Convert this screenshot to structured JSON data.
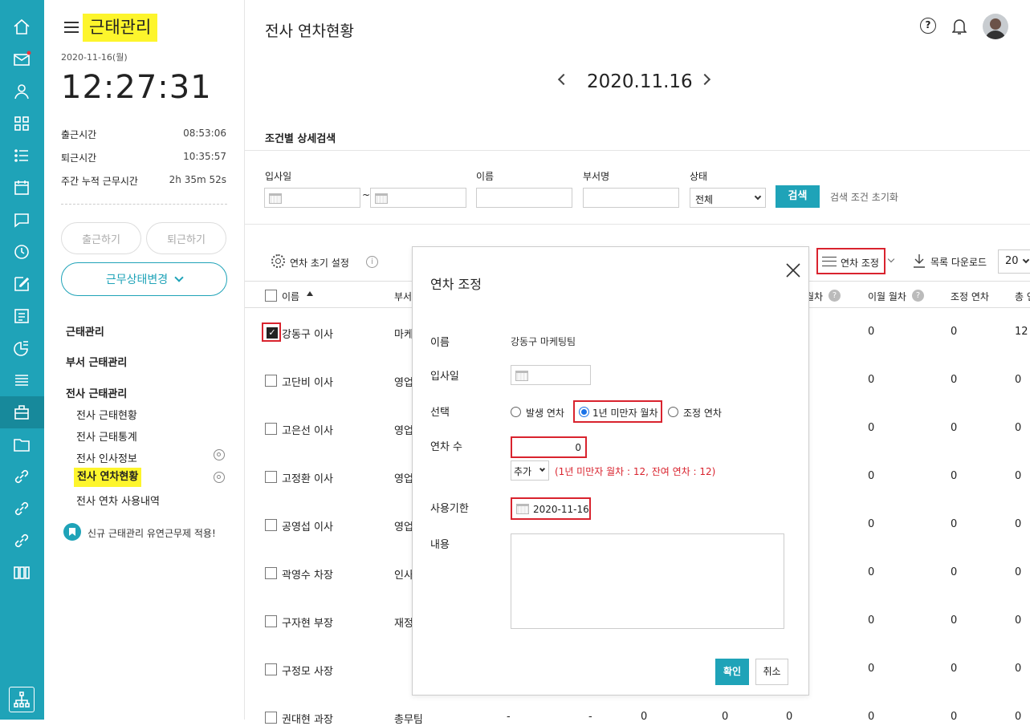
{
  "app_title": "근태관리",
  "date_label": "2020-11-16(월)",
  "clock": "12:27:31",
  "stats": [
    {
      "label": "출근시간",
      "value": "08:53:06"
    },
    {
      "label": "퇴근시간",
      "value": "10:35:57"
    },
    {
      "label": "주간 누적 근무시간",
      "value": "2h 35m 52s"
    }
  ],
  "buttons": {
    "clock_in": "출근하기",
    "clock_out": "퇴근하기",
    "status_change": "근무상태변경"
  },
  "menu": {
    "groups": [
      "근태관리",
      "부서 근태관리",
      "전사 근태관리"
    ],
    "sub": [
      "전사 근태현황",
      "전사 근태통계",
      "전사 인사정보",
      "전사 연차현황",
      "전사 연차 사용내역"
    ],
    "notice": "신규 근태관리 유연근무제 적용!"
  },
  "page_title": "전사 연차현황",
  "nav_date": "2020.11.16",
  "search": {
    "title": "조건별 상세검색",
    "labels": [
      "입사일",
      "이름",
      "부서명",
      "상태"
    ],
    "tilde": "~",
    "status_value": "전체",
    "search_btn": "검색",
    "reset": "검색 조건 초기화"
  },
  "toolbar": {
    "init": "연차 초기 설정",
    "adjust": "연차 조정",
    "download": "목록 다운로드",
    "page_size": "20"
  },
  "table": {
    "headers": {
      "name": "이름",
      "dept": "부서",
      "h_a": "월차",
      "h_b": "이월 월차",
      "h_c": "조정 연차",
      "h_d": "총 연"
    },
    "rows": [
      {
        "name": "강동구 이사",
        "dept": "마케",
        "a": "0",
        "b": "0",
        "c": "12"
      },
      {
        "name": "고단비 이사",
        "dept": "영업",
        "a": "0",
        "b": "0",
        "c": "0"
      },
      {
        "name": "고은선 이사",
        "dept": "영업",
        "a": "0",
        "b": "0",
        "c": "0"
      },
      {
        "name": "고정환 이사",
        "dept": "영업",
        "a": "0",
        "b": "0",
        "c": "0"
      },
      {
        "name": "공영섭 이사",
        "dept": "영업",
        "a": "0",
        "b": "0",
        "c": "0"
      },
      {
        "name": "곽영수 차장",
        "dept": "인사",
        "a": "0",
        "b": "0",
        "c": "0"
      },
      {
        "name": "구자현 부장",
        "dept": "재정",
        "a": "0",
        "b": "0",
        "c": "0"
      },
      {
        "name": "구정모 사장",
        "dept": "",
        "a": "0",
        "b": "0",
        "c": "0"
      },
      {
        "name": "권대현 과장",
        "dept": "총무팀",
        "a": "0",
        "b": "0",
        "c": "0"
      }
    ],
    "last_row_extra": {
      "d1": "-",
      "d2": "-",
      "n1": "0",
      "n2": "0",
      "n3": "0"
    }
  },
  "modal": {
    "title": "연차 조정",
    "labels": {
      "name": "이름",
      "join": "입사일",
      "select": "선택",
      "count": "연차 수",
      "expire": "사용기한",
      "content": "내용"
    },
    "name_value": "강동구 마케팅팀",
    "radios": [
      "발생 연차",
      "1년 미만자 월차",
      "조정 연차"
    ],
    "count_value": "0",
    "add_option": "추가",
    "info": "(1년 미만자 월차 : 12, 잔여 연차 : 12)",
    "expire_value": "2020-11-16",
    "confirm": "확인",
    "cancel": "취소"
  },
  "colors": {
    "accent": "#1fa3b8",
    "highlight": "#fdf52c",
    "alert": "#d9232e"
  }
}
